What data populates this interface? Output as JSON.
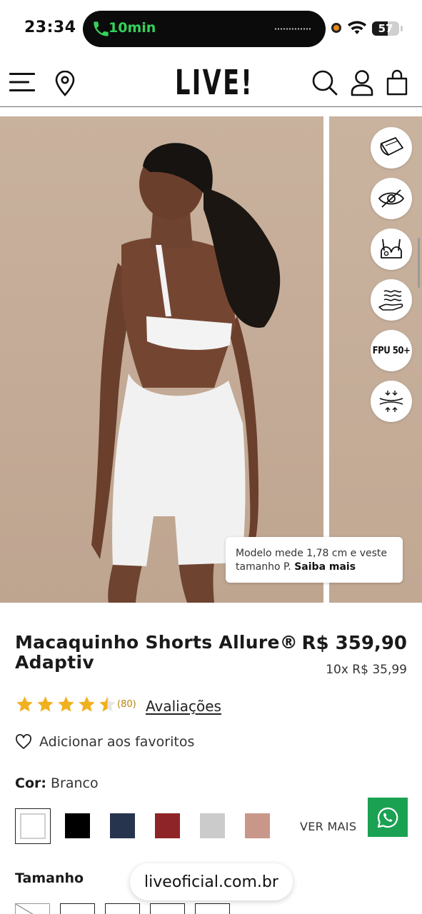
{
  "status_bar": {
    "time": "23:34",
    "call_duration": "10min",
    "battery": "57",
    "battery_level": 0.57,
    "accent_green": "#34d15a"
  },
  "header": {
    "logo": "LIVE!",
    "icons": [
      "menu-icon",
      "location-pin-icon",
      "search-icon",
      "user-icon",
      "shopping-bag-icon"
    ]
  },
  "gallery": {
    "feature_badges": [
      "fabric-icon",
      "no-see-through-icon",
      "built-in-bra-icon",
      "breathable-icon",
      "FPU 50+",
      "compression-icon"
    ],
    "fpu_label": "FPU 50+",
    "model_note": "Modelo mede 1,78 cm e veste tamanho P.",
    "model_note_link": "Saiba mais"
  },
  "product": {
    "title": "Macaquinho Shorts Allure® Adaptiv",
    "price": "R$ 359,90",
    "installments": "10x R$ 35,99",
    "rating": 4.5,
    "review_count": "(80)",
    "reviews_link": "Avaliações",
    "favorite_label": "Adicionar aos favoritos",
    "color_label": "Cor:",
    "color_value": "Branco",
    "swatches": [
      {
        "name": "Branco",
        "hex": "#ffffff"
      },
      {
        "name": "Preto",
        "hex": "#000000"
      },
      {
        "name": "Azul",
        "hex": "#26344e"
      },
      {
        "name": "Vermelho",
        "hex": "#8e2428"
      },
      {
        "name": "Cinza",
        "hex": "#cbcbcb"
      },
      {
        "name": "Rosa",
        "hex": "#c9978a"
      }
    ],
    "more_colors": "VER MAIS",
    "size_label": "Tamanho"
  },
  "browser": {
    "url": "liveoficial.com.br"
  },
  "colors": {
    "whatsapp_green": "#1aa152",
    "star_gold": "#f2b01e"
  }
}
